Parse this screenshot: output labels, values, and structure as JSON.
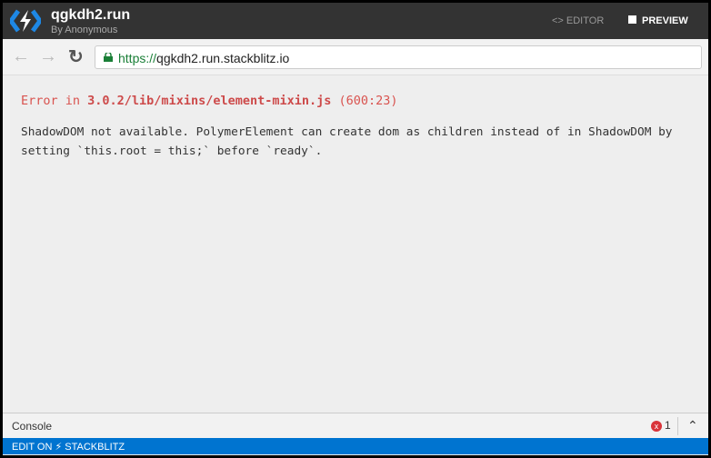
{
  "header": {
    "title": "qgkdh2.run",
    "subtitle": "By Anonymous",
    "editor_label": "<> EDITOR",
    "preview_label": "PREVIEW"
  },
  "browser": {
    "url_scheme": "https://",
    "url_rest": "qgkdh2.run.stackblitz.io"
  },
  "error": {
    "prefix": "Error in ",
    "file": "3.0.2/lib/mixins/element-mixin.js",
    "location": " (600:23)",
    "message": "ShadowDOM not available. PolymerElement can create dom as children instead of in ShadowDOM by setting `this.root = this;` before `ready`."
  },
  "console": {
    "label": "Console",
    "error_count": "1",
    "error_icon": "x"
  },
  "footer": {
    "edit_on": "EDIT ON",
    "brand": "STACKBLITZ"
  },
  "colors": {
    "header": "#333333",
    "accent": "#0074d0",
    "error": "#d9534f"
  }
}
